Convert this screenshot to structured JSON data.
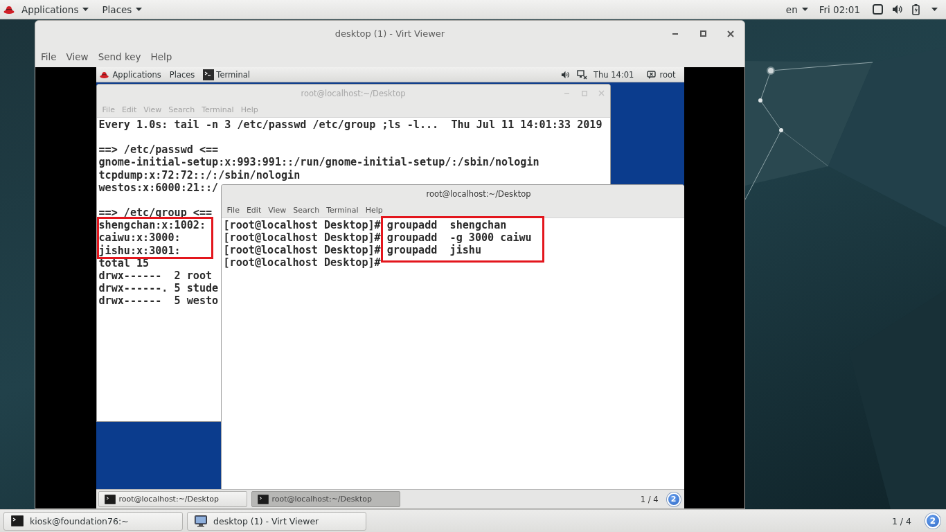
{
  "top_bar": {
    "menus": [
      "Applications",
      "Places"
    ],
    "language": "en",
    "clock": "Fri 02:01"
  },
  "viewer_window": {
    "title": "desktop (1) - Virt Viewer",
    "menu": [
      "File",
      "View",
      "Send key",
      "Help"
    ],
    "guest": {
      "top_bar": {
        "menus": [
          "Applications",
          "Places"
        ],
        "running_app": "Terminal",
        "clock": "Thu 14:01",
        "user": "root"
      },
      "windows": [
        {
          "kind": "watch",
          "title": "root@localhost:~/Desktop",
          "active": false,
          "clipped": false,
          "menu": [
            "File",
            "Edit",
            "View",
            "Search",
            "Terminal",
            "Help"
          ],
          "header": "Every 1.0s: tail -n 3 /etc/passwd /etc/group ;ls -l...  Thu Jul 11 14:01:33 2019",
          "sections": [
            {
              "lines": [
                {
                  "text": "==> /etc/passwd <==",
                  "highlighted": false
                },
                {
                  "text": "gnome-initial-setup:x:993:991::/run/gnome-initial-setup/:/sbin/nologin",
                  "highlighted": false
                },
                {
                  "text": "tcpdump:x:72:72::/:/sbin/nologin",
                  "highlighted": false
                },
                {
                  "text": "westos:x:6000:21::/",
                  "highlighted": false
                }
              ]
            },
            {
              "lines": [
                {
                  "text": "==> /etc/group <==",
                  "highlighted": false
                },
                {
                  "text": "shengchan:x:1002:",
                  "highlighted": true
                },
                {
                  "text": "caiwu:x:3000:",
                  "highlighted": true
                },
                {
                  "text": "jishu:x:3001:",
                  "highlighted": true
                },
                {
                  "text": "total 15",
                  "highlighted": false
                },
                {
                  "text": "drwx------  2 root",
                  "highlighted": false
                },
                {
                  "text": "drwx------. 5 stude",
                  "highlighted": false
                },
                {
                  "text": "drwx------  5 westo",
                  "highlighted": false
                }
              ]
            }
          ]
        },
        {
          "kind": "shell",
          "title": "root@localhost:~/Desktop",
          "active": true,
          "clipped": true,
          "menu": [
            "File",
            "Edit",
            "View",
            "Search",
            "Terminal",
            "Help"
          ],
          "commands_highlighted": true,
          "lines": [
            {
              "prompt": "[root@localhost Desktop]#",
              "command": "groupadd  shengchan"
            },
            {
              "prompt": "[root@localhost Desktop]#",
              "command": "groupadd  -g 3000 caiwu"
            },
            {
              "prompt": "[root@localhost Desktop]#",
              "command": "groupadd  jishu"
            },
            {
              "prompt": "[root@localhost Desktop]#"
            }
          ]
        }
      ],
      "taskbar": {
        "tasks": [
          {
            "label": "root@localhost:~/Desktop",
            "selected": false
          },
          {
            "label": "root@localhost:~/Desktop",
            "selected": true
          }
        ],
        "workspace": "1 / 4",
        "workspace_badge": "2"
      }
    }
  },
  "taskbar": {
    "tasks": [
      {
        "kind": "terminal",
        "label": "kiosk@foundation76:~",
        "selected": false
      },
      {
        "kind": "viewer",
        "label": "desktop (1) - Virt Viewer",
        "selected": false
      }
    ],
    "workspace": "1 / 4",
    "workspace_badge": "2"
  }
}
